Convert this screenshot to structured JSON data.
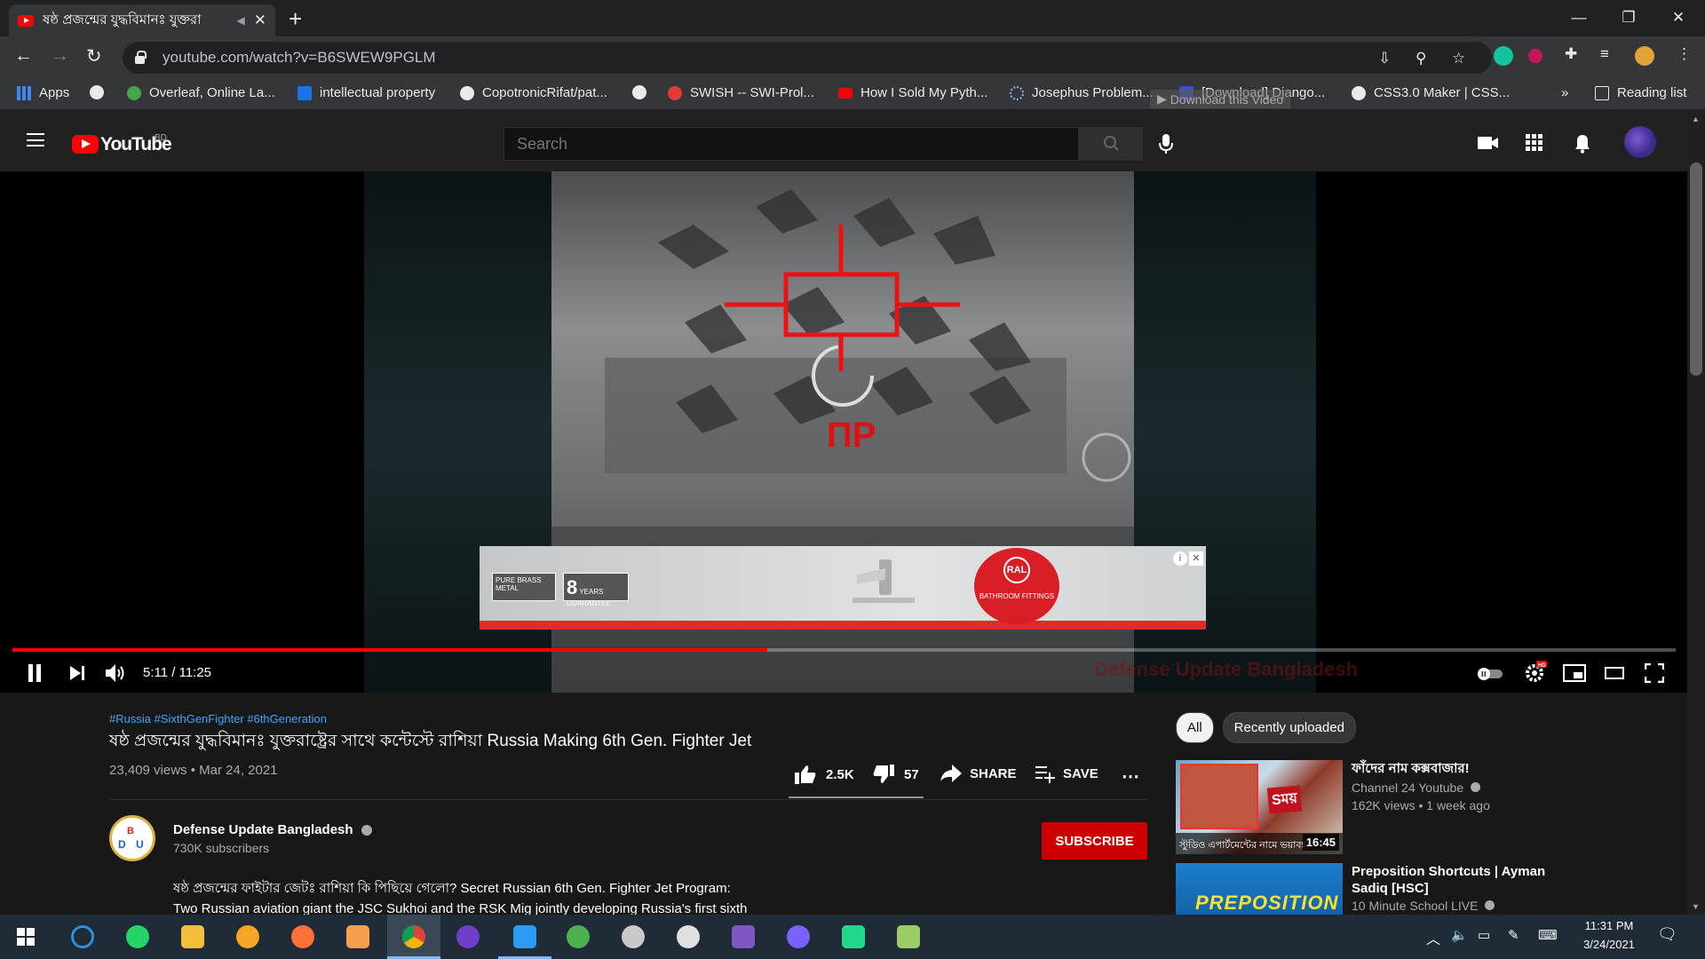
{
  "browser": {
    "tab_title": "ষষ্ঠ প্রজন্মের যুদ্ধবিমানঃ যুক্তরা",
    "new_tab": "+",
    "url": "youtube.com/watch?v=B6SWEW9PGLM",
    "window_controls": [
      "—",
      "❐",
      "✕"
    ],
    "bookmarks": [
      {
        "label": "Apps",
        "color": "#e8eaed"
      },
      {
        "label": "",
        "color": "#e8eaed"
      },
      {
        "label": "Overleaf, Online La...",
        "color": "#46a548"
      },
      {
        "label": "intellectual property",
        "color": "#1a73e8"
      },
      {
        "label": "CopotronicRifat/pat...",
        "color": "#e8eaed"
      },
      {
        "label": "",
        "color": "#e8eaed"
      },
      {
        "label": "SWISH -- SWI-Prol...",
        "color": "#e53935"
      },
      {
        "label": "How I Sold My Pyth...",
        "color": "#ff0000"
      },
      {
        "label": "Josephus Problem...",
        "color": "#8ab4f8"
      },
      {
        "label": "[Download] Django...",
        "color": "#3f51b5"
      },
      {
        "label": "CSS3.0 Maker | CSS...",
        "color": "#e8eaed"
      }
    ],
    "bookmarks_more": "»",
    "reading_list": "Reading list",
    "download_overlay": "Download this Video"
  },
  "youtube": {
    "logo_text": "YouTube",
    "country_code": "BD",
    "search_placeholder": "Search"
  },
  "player": {
    "time": "5:11 / 11:25",
    "progress": 0.4536,
    "watermark": "Defense Update Bangladesh",
    "ad": {
      "badge1": "PURE BRASS METAL",
      "badge2_num": "8",
      "badge2_text": "YEARS GUARANTEE",
      "logo_text": "BATHROOM FITTINGS",
      "logo_mark": "RAL"
    }
  },
  "video": {
    "hashtags": "#Russia #SixthGenFighter #6thGeneration",
    "title": "ষষ্ঠ প্রজন্মের যুদ্ধবিমানঃ যুক্তরাষ্ট্রের সাথে কন্টেস্টে রাশিয়া Russia Making 6th Gen. Fighter Jet",
    "meta": "23,409 views • Mar 24, 2021",
    "likes": "2.5K",
    "dislikes": "57",
    "share": "SHARE",
    "save": "SAVE",
    "channel": "Defense Update Bangladesh",
    "subscribers": "730K subscribers",
    "subscribe": "SUBSCRIBE",
    "description_line1": "ষষ্ঠ প্রজন্মের ফাইটার জেটঃ রাশিয়া কি পিছিয়ে গেলো? Secret Russian 6th Gen. Fighter Jet Program:",
    "description_line2": "Two Russian aviation giant the JSC Sukhoi and the RSK Mig jointly developing Russia's first sixth"
  },
  "sidebar": {
    "chips": [
      "All",
      "Recently uploaded"
    ],
    "videos": [
      {
        "title": "ফাঁদের নাম কক্সবাজার!",
        "channel": "Channel 24 Youtube",
        "meta": "162K views • 1 week ago",
        "duration": "16:45",
        "thumb_caption": "স্টুডিও এপার্টমেন্টের নামে ভয়াবহ"
      },
      {
        "title": "Preposition Shortcuts | Ayman Sadiq [HSC]",
        "channel": "10 Minute School LIVE",
        "meta": "",
        "duration": "",
        "thumb_caption": "PREPOSITION"
      }
    ]
  },
  "taskbar": {
    "time": "11:31 PM",
    "date": "3/24/2021"
  }
}
